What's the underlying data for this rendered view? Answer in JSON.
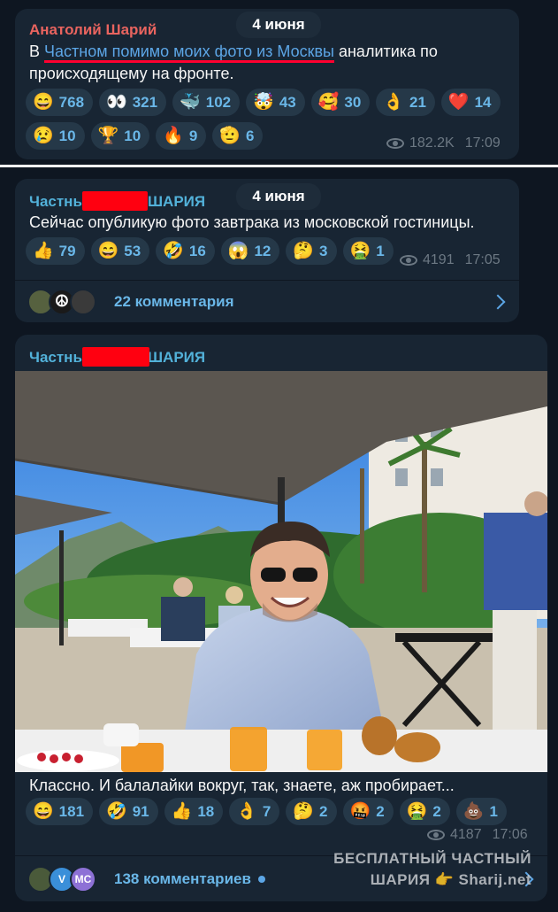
{
  "messages": [
    {
      "sender": "Анатолий Шарий",
      "date_pill": "4 июня",
      "text_prefix": "В ",
      "text_link": "Частном помимо моих фото из Москвы",
      "text_suffix": " аналитика по происходящему на фронте.",
      "reactions": [
        {
          "emoji": "😄",
          "count": "768"
        },
        {
          "emoji": "👀",
          "count": "321"
        },
        {
          "emoji": "🐳",
          "count": "102"
        },
        {
          "emoji": "🤯",
          "count": "43"
        },
        {
          "emoji": "🥰",
          "count": "30"
        },
        {
          "emoji": "👌",
          "count": "21"
        },
        {
          "emoji": "❤️",
          "count": "14"
        },
        {
          "emoji": "😢",
          "count": "10"
        },
        {
          "emoji": "🏆",
          "count": "10"
        },
        {
          "emoji": "🔥",
          "count": "9"
        },
        {
          "emoji": "🫡",
          "count": "6"
        }
      ],
      "views": "182.2K",
      "time": "17:09"
    },
    {
      "sender_left": "Частны",
      "sender_right": "ШАРИЯ",
      "date_pill": "4 июня",
      "text": "Сейчас опубликую фото завтрака из московской гостиницы.",
      "reactions": [
        {
          "emoji": "👍",
          "count": "79"
        },
        {
          "emoji": "😄",
          "count": "53"
        },
        {
          "emoji": "🤣",
          "count": "16"
        },
        {
          "emoji": "😱",
          "count": "12"
        },
        {
          "emoji": "🤔",
          "count": "3"
        },
        {
          "emoji": "🤮",
          "count": "1"
        }
      ],
      "views": "4191",
      "time": "17:05",
      "comments_label": "22 комментария"
    },
    {
      "sender_left": "Частны",
      "sender_right": "ШАРИЯ",
      "text": "Классно. И балалайки вокруг, так, знаете, аж пробирает...",
      "reactions": [
        {
          "emoji": "😄",
          "count": "181"
        },
        {
          "emoji": "🤣",
          "count": "91"
        },
        {
          "emoji": "👍",
          "count": "18"
        },
        {
          "emoji": "👌",
          "count": "7"
        },
        {
          "emoji": "🤔",
          "count": "2"
        },
        {
          "emoji": "🤬",
          "count": "2"
        },
        {
          "emoji": "🤮",
          "count": "2"
        },
        {
          "emoji": "💩",
          "count": "1"
        }
      ],
      "views": "4187",
      "time": "17:06",
      "comments_label": "138 комментариев",
      "avatar_initials": [
        "V",
        "MC"
      ]
    }
  ],
  "watermark": {
    "line1": "БЕСПЛАТНЫЙ ЧАСТНЫЙ",
    "line2": "ШАРИЯ 👉 Sharij.net"
  },
  "colors": {
    "background": "#0e1621",
    "bubble": "#182533",
    "link": "#5ca6e6",
    "sender_red": "#e9645f",
    "sender_blue": "#52b1d9"
  }
}
